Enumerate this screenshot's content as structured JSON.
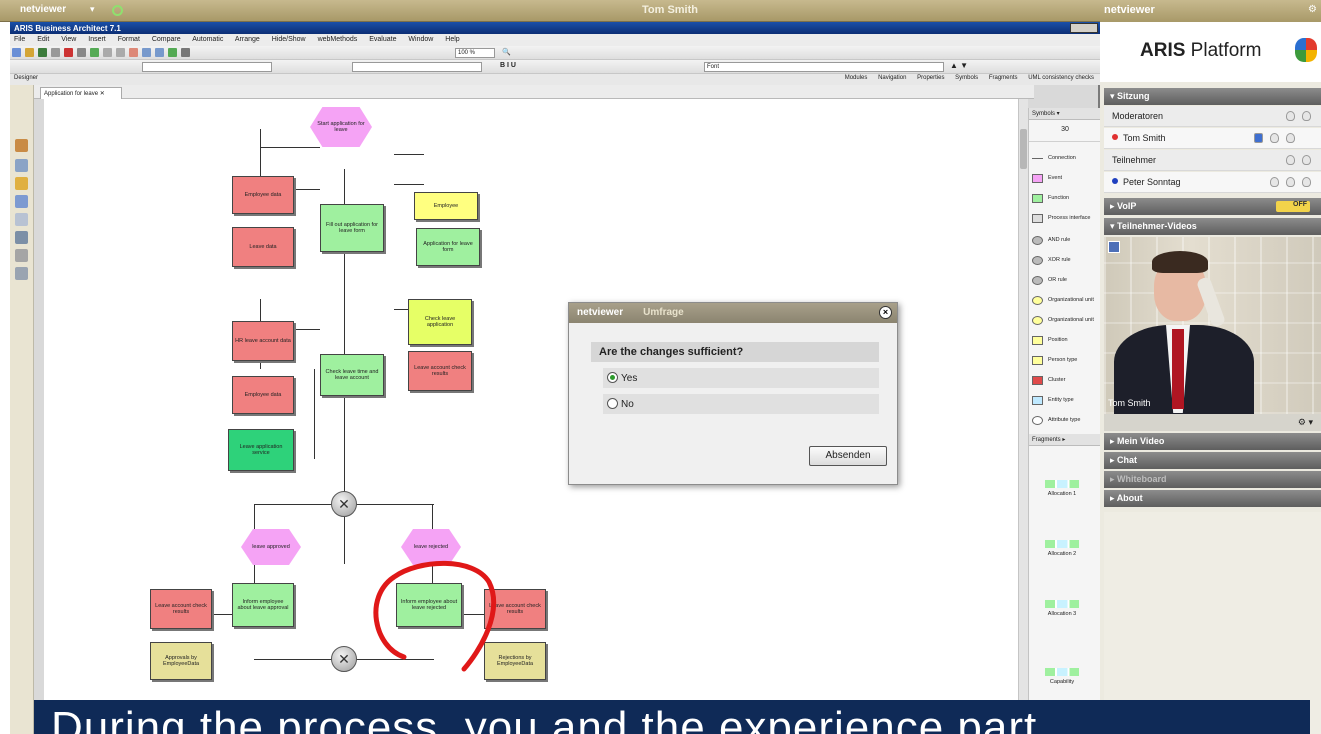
{
  "netviewer_bar": {
    "brand": "netviewer",
    "title": "Tom Smith"
  },
  "aris": {
    "window_title": "ARIS Business Architect 7.1",
    "menu": [
      "File",
      "Edit",
      "View",
      "Insert",
      "Format",
      "Compare",
      "Automatic",
      "Arrange",
      "Hide/Show",
      "webMethods",
      "Evaluate",
      "Window",
      "Help"
    ],
    "zoom": "100 %",
    "font_field": "Font",
    "panel_title": "Designer",
    "view_options": [
      "Modules",
      "Navigation",
      "Properties",
      "Symbols",
      "Fragments",
      "UML consistency checks"
    ],
    "doc_tab": "Application for leave"
  },
  "diagram": {
    "events": {
      "start": "Start application for leave",
      "approved": "leave approved",
      "rejected": "leave rejected"
    },
    "nodes": {
      "employee_data": "Employee data",
      "leave_data": "Leave data",
      "fill_out": "Fill out application for leave form",
      "employee": "Employee",
      "application_form": "Application for leave form",
      "hr_leave_data": "HR leave account data",
      "check_leave": "Check leave application",
      "check_time": "Check leave time and leave account",
      "check_result": "Leave account check results",
      "employee_data2": "Employee data",
      "service": "Leave application service",
      "inform_approved": "Inform employee about leave approval",
      "inform_rejected": "Inform employee about leave rejected",
      "check_result_a": "Leave account check results",
      "check_result_b": "Leave account check results",
      "approvals": "Approvals by EmployeeData",
      "rejections": "Rejections by EmployeeData"
    }
  },
  "palette": {
    "symbols_title": "Symbols",
    "count": "30",
    "items": [
      "Connection",
      "Event",
      "Function",
      "Process interface",
      "AND rule",
      "XOR rule",
      "OR rule",
      "Organizational unit",
      "Organizational unit",
      "Position",
      "Person type",
      "Cluster",
      "Entity type",
      "Attribute type"
    ],
    "fragments_title": "Fragments",
    "fragments": [
      "Allocation 1",
      "Allocation 2",
      "Allocation 3",
      "Capability"
    ]
  },
  "dialog": {
    "brand": "netviewer",
    "title": "Umfrage",
    "question": "Are the changes sufficient?",
    "options": [
      "Yes",
      "No"
    ],
    "selected": "Yes",
    "submit": "Absenden"
  },
  "nv_panel": {
    "brand": "netviewer",
    "logo_strong": "ARIS",
    "logo_rest": " Platform",
    "session_title": "Sitzung",
    "moderators_label": "Moderatoren",
    "moderator": "Tom Smith",
    "participants_label": "Teilnehmer",
    "participant": "Peter Sonntag",
    "voip": "VoIP",
    "voip_toggle": "OFF",
    "videos_title": "Teilnehmer-Videos",
    "video_name": "Tom Smith",
    "my_video": "Mein Video",
    "chat": "Chat",
    "whiteboard": "Whiteboard",
    "about": "About",
    "colors": {
      "moderator_dot": "#e03030",
      "participant_dot": "#1f3fbf"
    }
  },
  "caption": "During the process, you and the experience part"
}
